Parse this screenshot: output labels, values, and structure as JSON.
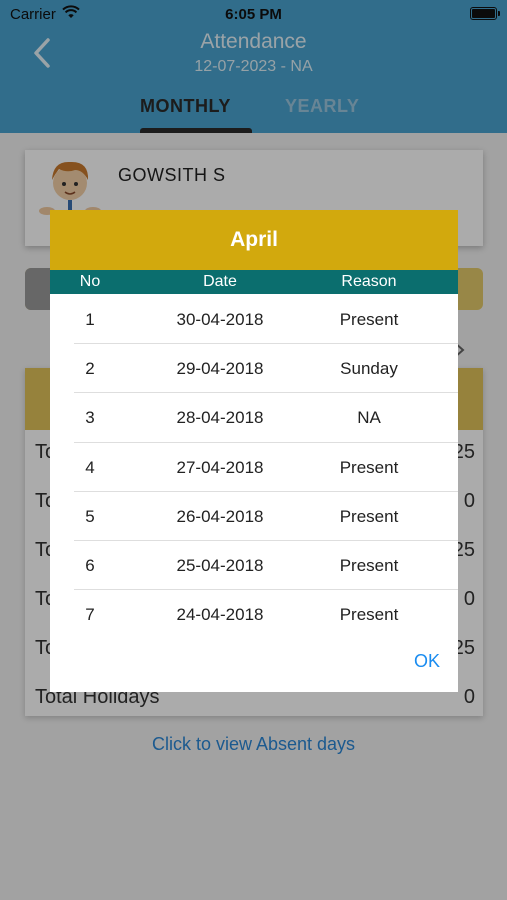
{
  "status_bar": {
    "carrier": "Carrier",
    "time": "6:05 PM"
  },
  "nav": {
    "title": "Attendance",
    "subtitle": "12-07-2023 - NA"
  },
  "tabs": [
    {
      "label": "MONTHLY",
      "selected": true
    },
    {
      "label": "YEARLY",
      "selected": false
    }
  ],
  "profile": {
    "name": "GOWSITH S"
  },
  "summary": {
    "rows": [
      {
        "label": "To",
        "value": "25"
      },
      {
        "label": "To",
        "value": "0"
      },
      {
        "label": "To",
        "value": "25"
      },
      {
        "label": "To",
        "value": "0"
      },
      {
        "label": "To",
        "value": "25"
      },
      {
        "label": "Total Holidays",
        "value": "0"
      }
    ],
    "link_text": "Click to view Absent days"
  },
  "dialog": {
    "title": "April",
    "columns": {
      "no": "No",
      "date": "Date",
      "reason": "Reason"
    },
    "rows": [
      {
        "no": "1",
        "date": "30-04-2018",
        "reason": "Present"
      },
      {
        "no": "2",
        "date": "29-04-2018",
        "reason": "Sunday"
      },
      {
        "no": "3",
        "date": "28-04-2018",
        "reason": "NA"
      },
      {
        "no": "4",
        "date": "27-04-2018",
        "reason": "Present"
      },
      {
        "no": "5",
        "date": "26-04-2018",
        "reason": "Present"
      },
      {
        "no": "6",
        "date": "25-04-2018",
        "reason": "Present"
      },
      {
        "no": "7",
        "date": "24-04-2018",
        "reason": "Present"
      }
    ],
    "ok_label": "OK"
  },
  "colors": {
    "header": "#4aa3cf",
    "dialog_title": "#d2a90d",
    "table_header": "#0b6e6e",
    "link": "#2a86d6"
  },
  "icons": [
    "wifi-icon",
    "battery-icon",
    "back-chevron-icon",
    "avatar-icon",
    "chevron-right-icon"
  ]
}
